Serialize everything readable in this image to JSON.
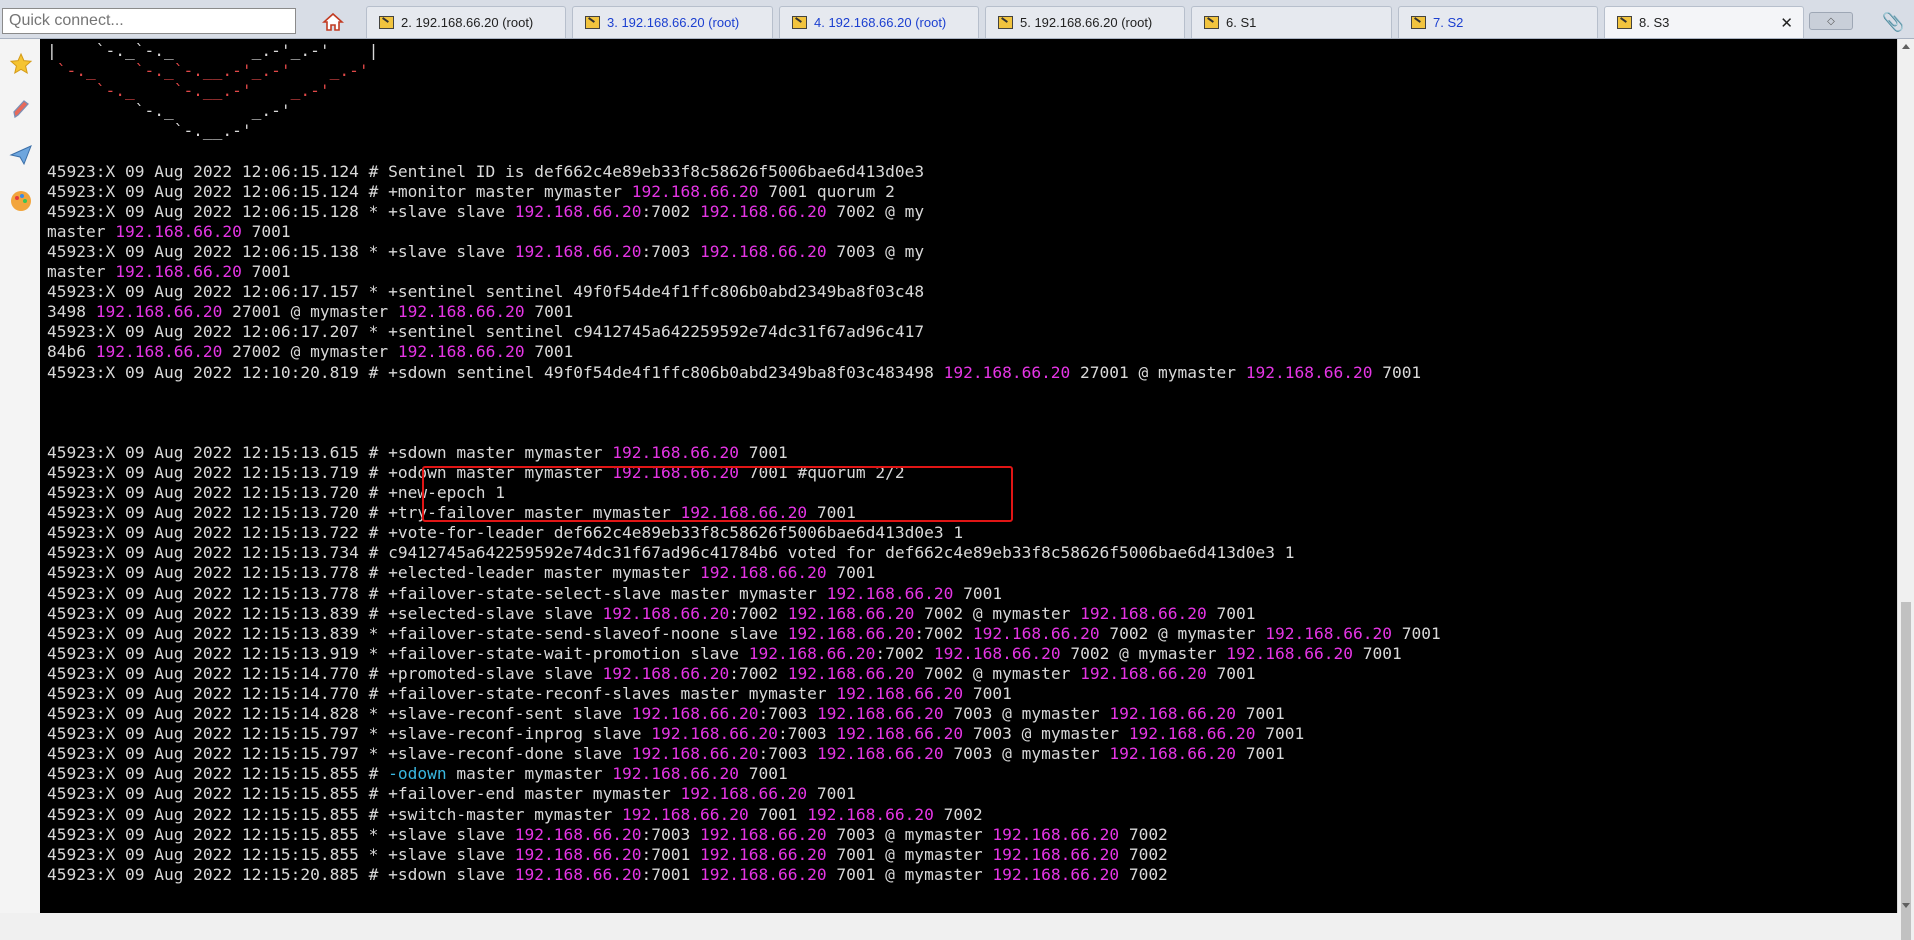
{
  "quick_connect_placeholder": "Quick connect...",
  "tabs": [
    {
      "label": "2. 192.168.66.20 (root)",
      "color": "black"
    },
    {
      "label": "3. 192.168.66.20 (root)",
      "color": "blue"
    },
    {
      "label": "4. 192.168.66.20 (root)",
      "color": "blue"
    },
    {
      "label": "5. 192.168.66.20 (root)",
      "color": "black"
    },
    {
      "label": "6. S1",
      "color": "black"
    },
    {
      "label": "7. S2",
      "color": "blue"
    },
    {
      "label": "8. S3",
      "color": "black",
      "active": true
    }
  ],
  "colors": {
    "ip": "#e535e5",
    "odown": "#39b7e0",
    "highlight_box": "#e01515",
    "terminal_bg": "#000000"
  },
  "sidebar_icons": [
    "star-icon",
    "pen-icon",
    "paper-plane-icon",
    "palette-icon"
  ],
  "terminal": {
    "ascii_art": [
      "|    `-._`-._        _.-'_.-'    |",
      " `-._    `-._`-.__.-'_.-'    _.-'",
      "     `-._    `-.__.-'    _.-'",
      "         `-._        _.-'",
      "             `-.__.-'"
    ],
    "lines": [
      "",
      "45923:X 09 Aug 2022 12:06:15.124 # Sentinel ID is def662c4e89eb33f8c58626f5006bae6d413d0e3",
      "45923:X 09 Aug 2022 12:06:15.124 # +monitor master mymaster {ip} 7001 quorum 2",
      "45923:X 09 Aug 2022 12:06:15.128 * +slave slave {ip}:7002 {ip} 7002 @ my",
      "master {ip} 7001",
      "45923:X 09 Aug 2022 12:06:15.138 * +slave slave {ip}:7003 {ip} 7003 @ my",
      "master {ip} 7001",
      "45923:X 09 Aug 2022 12:06:17.157 * +sentinel sentinel 49f0f54de4f1ffc806b0abd2349ba8f03c48",
      "3498 {ip} 27001 @ mymaster {ip} 7001",
      "45923:X 09 Aug 2022 12:06:17.207 * +sentinel sentinel c9412745a642259592e74dc31f67ad96c417",
      "84b6 {ip} 27002 @ mymaster {ip} 7001",
      "45923:X 09 Aug 2022 12:10:20.819 # +sdown sentinel 49f0f54de4f1ffc806b0abd2349ba8f03c483498 {ip} 27001 @ mymaster {ip} 7001",
      "",
      "",
      "",
      "45923:X 09 Aug 2022 12:15:13.615 # +sdown master mymaster {ip} 7001",
      "45923:X 09 Aug 2022 12:15:13.719 # +odown master mymaster {ip} 7001 #quorum 2/2",
      "45923:X 09 Aug 2022 12:15:13.720 # +new-epoch 1",
      "45923:X 09 Aug 2022 12:15:13.720 # +try-failover master mymaster {ip} 7001",
      "45923:X 09 Aug 2022 12:15:13.722 # +vote-for-leader def662c4e89eb33f8c58626f5006bae6d413d0e3 1",
      "45923:X 09 Aug 2022 12:15:13.734 # c9412745a642259592e74dc31f67ad96c41784b6 voted for def662c4e89eb33f8c58626f5006bae6d413d0e3 1",
      "45923:X 09 Aug 2022 12:15:13.778 # +elected-leader master mymaster {ip} 7001",
      "45923:X 09 Aug 2022 12:15:13.778 # +failover-state-select-slave master mymaster {ip} 7001",
      "45923:X 09 Aug 2022 12:15:13.839 # +selected-slave slave {ip}:7002 {ip} 7002 @ mymaster {ip} 7001",
      "45923:X 09 Aug 2022 12:15:13.839 * +failover-state-send-slaveof-noone slave {ip}:7002 {ip} 7002 @ mymaster {ip} 7001",
      "45923:X 09 Aug 2022 12:15:13.919 * +failover-state-wait-promotion slave {ip}:7002 {ip} 7002 @ mymaster {ip} 7001",
      "45923:X 09 Aug 2022 12:15:14.770 # +promoted-slave slave {ip}:7002 {ip} 7002 @ mymaster {ip} 7001",
      "45923:X 09 Aug 2022 12:15:14.770 # +failover-state-reconf-slaves master mymaster {ip} 7001",
      "45923:X 09 Aug 2022 12:15:14.828 * +slave-reconf-sent slave {ip}:7003 {ip} 7003 @ mymaster {ip} 7001",
      "45923:X 09 Aug 2022 12:15:15.797 * +slave-reconf-inprog slave {ip}:7003 {ip} 7003 @ mymaster {ip} 7001",
      "45923:X 09 Aug 2022 12:15:15.797 * +slave-reconf-done slave {ip}:7003 {ip} 7003 @ mymaster {ip} 7001",
      "45923:X 09 Aug 2022 12:15:15.855 # {odown} master mymaster {ip} 7001",
      "45923:X 09 Aug 2022 12:15:15.855 # +failover-end master mymaster {ip} 7001",
      "45923:X 09 Aug 2022 12:15:15.855 # +switch-master mymaster {ip} 7001 {ip} 7002",
      "45923:X 09 Aug 2022 12:15:15.855 * +slave slave {ip}:7003 {ip} 7003 @ mymaster {ip} 7002",
      "45923:X 09 Aug 2022 12:15:15.855 * +slave slave {ip}:7001 {ip} 7001 @ mymaster {ip} 7002",
      "45923:X 09 Aug 2022 12:15:20.885 # +sdown slave {ip}:7001 {ip} 7001 @ mymaster {ip} 7002"
    ],
    "ip": "192.168.66.20",
    "odown_token": "-odown"
  }
}
